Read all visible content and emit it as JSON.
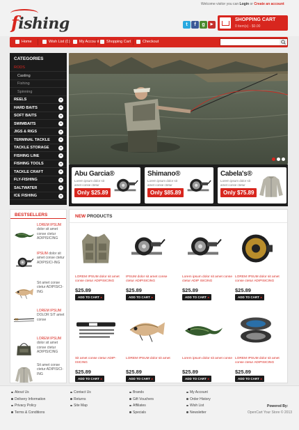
{
  "header": {
    "logo": {
      "first": "f",
      "rest": "ishing"
    },
    "welcome": "Welcome visitor you can",
    "login": "Login",
    "or": "or",
    "create_account": "Create an account",
    "social": [
      "twitter-icon",
      "facebook-icon",
      "google-icon",
      "youtube-icon"
    ],
    "cart": {
      "title": "SHOPPING CART",
      "summary": "0 item(s) - $0.00"
    }
  },
  "menu": [
    "Home",
    "Wish List (0)",
    "My Account",
    "Shopping Cart",
    "Checkout"
  ],
  "search": {
    "placeholder": ""
  },
  "categories": {
    "title": "CATEGORIES",
    "items": [
      {
        "label": "RODS",
        "kind": "active"
      },
      {
        "label": "Casting",
        "kind": "sub-white"
      },
      {
        "label": "Fishing",
        "kind": "sub"
      },
      {
        "label": "Spinning",
        "kind": "sub"
      },
      {
        "label": "REELS",
        "kind": "main"
      },
      {
        "label": "HARD BAITS",
        "kind": "main"
      },
      {
        "label": "SOFT BAITS",
        "kind": "main"
      },
      {
        "label": "SWIMBAITS",
        "kind": "main"
      },
      {
        "label": "JIGS & RIGS",
        "kind": "main"
      },
      {
        "label": "TERMINAL TACKLE",
        "kind": "main"
      },
      {
        "label": "TACKLE STORAGE",
        "kind": "main"
      },
      {
        "label": "FISHING LINE",
        "kind": "main"
      },
      {
        "label": "FISHING TOOLS",
        "kind": "main"
      },
      {
        "label": "TACKLE CRAFT",
        "kind": "main"
      },
      {
        "label": "FLY-FISHING",
        "kind": "main"
      },
      {
        "label": "SALTWATER",
        "kind": "main"
      },
      {
        "label": "ICE FISHING",
        "kind": "main"
      }
    ]
  },
  "promos": [
    {
      "brand": "Abu Garcia®",
      "desc": "Lorem ipsum dolor sit amet conse ctetur",
      "price": "Only $25.89",
      "img": "reel"
    },
    {
      "brand": "Shimano®",
      "desc": "Lorem ipsum dolor sit amet conse ctetur",
      "price": "Only $85.89",
      "img": "reel"
    },
    {
      "brand": "Cabela's®",
      "desc": "Lorem ipsum dolor sit amet conse ctetur",
      "price": "Only $75.89",
      "img": "jacket"
    }
  ],
  "bestsellers": {
    "title": "BESTSELLERS",
    "items": [
      {
        "red": "LOREM IPSUM",
        "rest": "dolor sit amet conse ctetur ADIPISICING",
        "img": "lure-green"
      },
      {
        "red": "IPSUM",
        "rest": "dolor sit amet conse ctetur ADIPISICI-ING",
        "img": "reel"
      },
      {
        "red": "",
        "rest": "Sit amet conse ctetur ADIPISICI-ING",
        "img": "lure-fish"
      },
      {
        "red": "LOREM IPSUM",
        "rest": "DOLOR SIT amet conse",
        "img": "rod"
      },
      {
        "red": "LOREM IPSUM",
        "rest": "dolor sit amet conse ctetur ADIPISICING",
        "img": "bag"
      },
      {
        "red": "",
        "rest": "Sit amet conse ctetur ADIPISICI-ING",
        "img": "jacket"
      }
    ]
  },
  "new_products": {
    "title_red": "NEW",
    "title_rest": "PRODUCTS",
    "add_to_cart": "ADD TO CART",
    "items": [
      {
        "name": "LOREM IPSUM dolor sit amet conse ctetur ADIPISICING",
        "price": "$25.89",
        "img": "vest"
      },
      {
        "name": "IPSUM dolor sit amet conse ctetur ADIPISICING",
        "price": "$25.89",
        "img": "reel"
      },
      {
        "name": "Lorem ipsum dolor sit amet conse ctetur ADIP ISICING",
        "price": "$25.89",
        "img": "reel"
      },
      {
        "name": "LOREM IPSUM dolor sit amet conse ctetur ADIPISICING",
        "price": "$25.89",
        "img": "flyreel"
      },
      {
        "name": "Sit amet conse ctetur ADIP-ISICING",
        "price": "$25.89",
        "img": "rodcase"
      },
      {
        "name": "LOREM IPSUM dolor sit amet",
        "price": "$25.89",
        "img": "lure-fish"
      },
      {
        "name": "Lorem ipsum dolor sit amet conse",
        "price": "$25.89",
        "img": "lure-green"
      },
      {
        "name": "LOREM IPSUM dolor sit amet conse ctetur ADIPISICING",
        "price": "$25.89",
        "img": "line"
      }
    ]
  },
  "footer": {
    "col1": [
      "About Us",
      "Delivery Information",
      "Privacy Policy",
      "Terms & Conditions"
    ],
    "col2": [
      "Contact Us",
      "Returns",
      "Site Map"
    ],
    "col3": [
      "Brands",
      "Gift Vouchers",
      "Affiliates",
      "Specials"
    ],
    "col4": [
      "My Account",
      "Order History",
      "Wish List",
      "Newsletter"
    ],
    "powered": "Powered By:",
    "copyright": "OpenCart  Your Store © 2013"
  },
  "colors": {
    "accent": "#d8261e",
    "dark": "#1b1b1b"
  }
}
